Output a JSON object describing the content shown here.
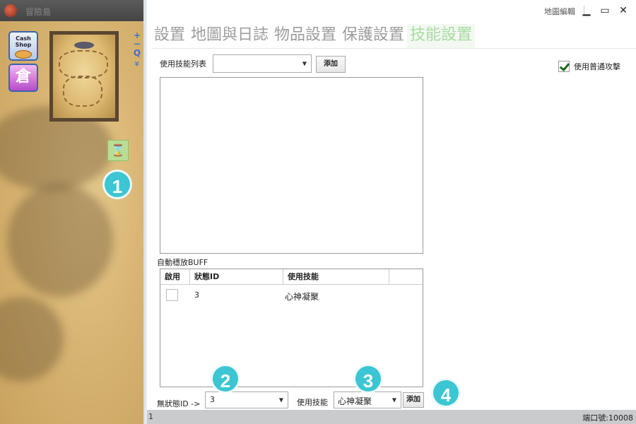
{
  "game": {
    "window_title": "冒險島",
    "cash_shop_label": "Cash Shop",
    "storage_label": "倉",
    "zoom_in": "+",
    "zoom_out": "−",
    "search": "Q",
    "expand": "»",
    "hourglass_icon": "hourglass-icon"
  },
  "callouts": [
    "1",
    "2",
    "3",
    "4"
  ],
  "window": {
    "title": "地圖編輯",
    "minimize": "▁",
    "maximize": "▭",
    "close": "✕"
  },
  "tabs": [
    {
      "label": "設置",
      "active": false
    },
    {
      "label": "地圖與日誌",
      "active": false
    },
    {
      "label": "物品設置",
      "active": false
    },
    {
      "label": "保護設置",
      "active": false
    },
    {
      "label": "技能設置",
      "active": true
    }
  ],
  "skills": {
    "list_label": "使用技能列表",
    "select_value": "",
    "add_label": "添加",
    "normal_attack_label": "使用普通攻擊",
    "normal_attack_checked": true
  },
  "buff": {
    "section_label": "自動穩放BUFF",
    "columns": [
      "啟用",
      "狀態ID",
      "使用技能"
    ],
    "rows": [
      {
        "enabled": false,
        "state_id": "3",
        "skill": "心神凝聚"
      }
    ]
  },
  "bottom": {
    "no_state_label": "無狀態ID ->",
    "state_value": "3",
    "use_skill_label": "使用技能",
    "use_skill_value": "心神凝聚",
    "add_label": "添加"
  },
  "status": {
    "left": "1",
    "port": "端口號:10008"
  },
  "colors": {
    "accent": "#3cc6d3",
    "active_tab": "#a7dba0",
    "inactive_tab": "#9d9d9d"
  }
}
